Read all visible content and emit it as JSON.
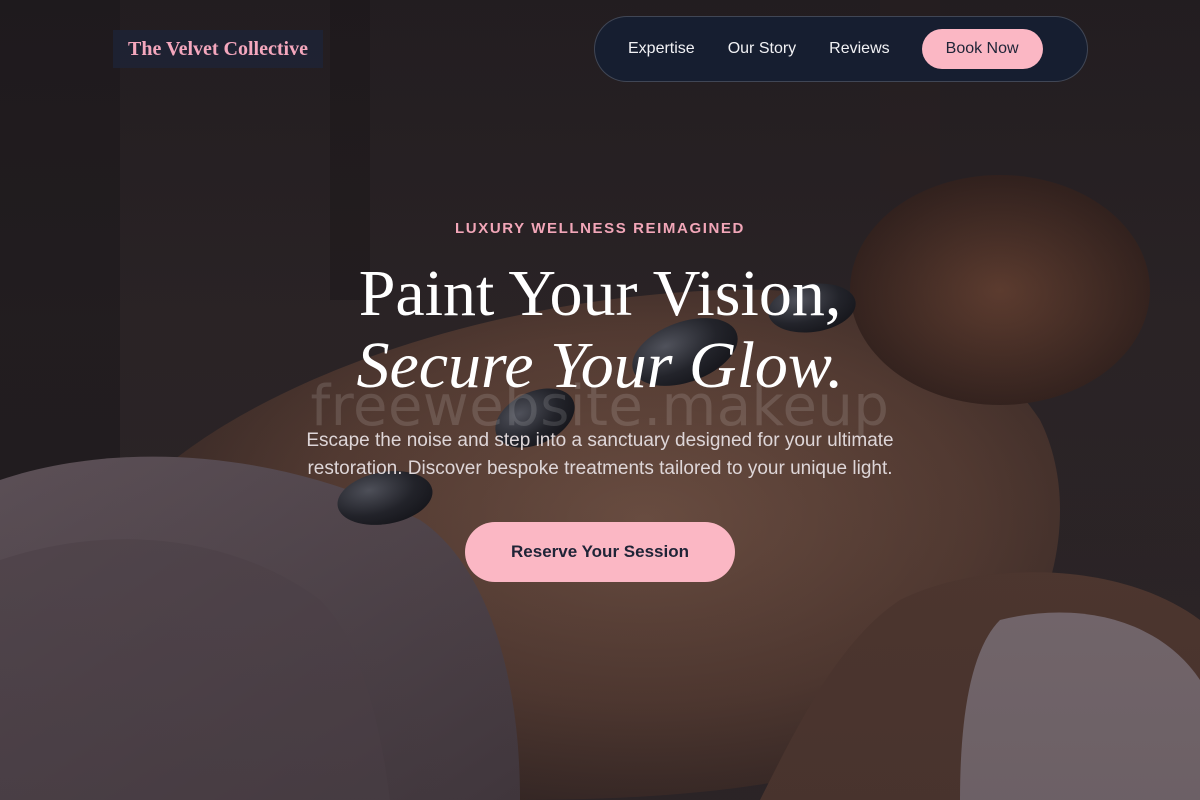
{
  "brand": {
    "name": "The Velvet Collective"
  },
  "nav": {
    "links": [
      "Expertise",
      "Our Story",
      "Reviews"
    ],
    "cta_label": "Book Now"
  },
  "hero": {
    "eyebrow": "LUXURY WELLNESS REIMAGINED",
    "headline_line1": "Paint Your Vision,",
    "headline_line2": "Secure Your Glow.",
    "watermark": "freewebsite.makeup",
    "subtext": "Escape the noise and step into a sanctuary designed for your ultimate restoration. Discover bespoke treatments tailored to your unique light.",
    "cta_label": "Reserve Your Session",
    "background_image": "hot-stone-massage-photo"
  },
  "colors": {
    "accent_pink": "#fbb7c4",
    "logo_pink": "#f4a7bd",
    "nav_bg": "#161e32",
    "dark_text": "#1f2437"
  }
}
